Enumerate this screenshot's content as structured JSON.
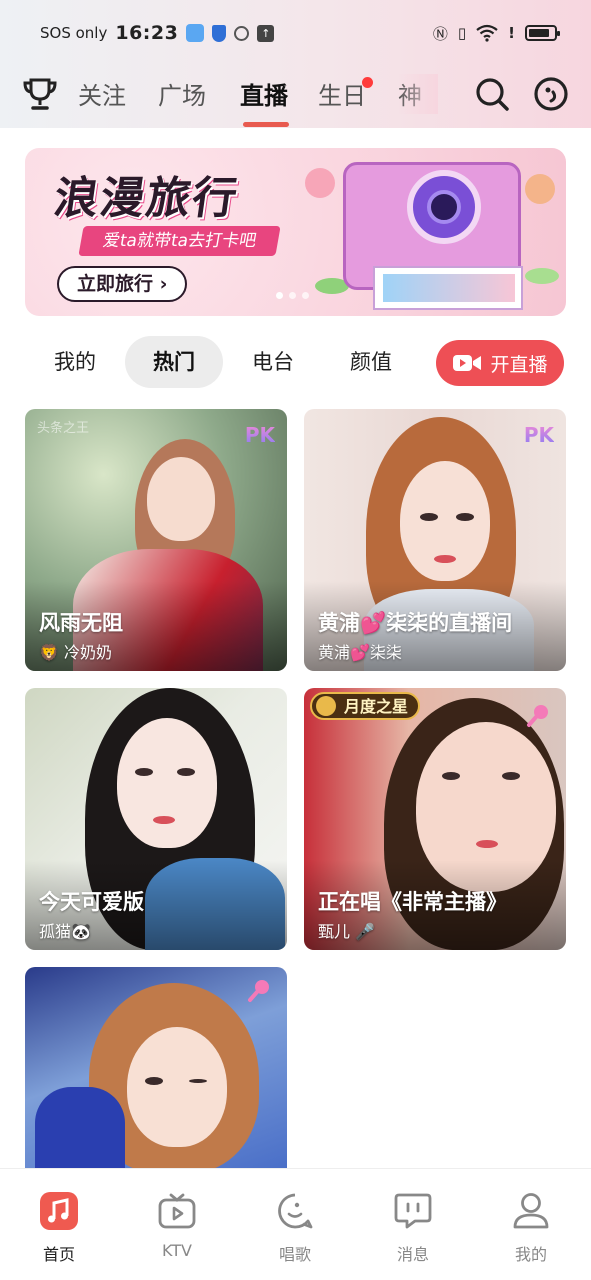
{
  "status_bar": {
    "carrier": "SOS only",
    "time": "16:23"
  },
  "nav": {
    "tabs": [
      {
        "label": "关注"
      },
      {
        "label": "广场"
      },
      {
        "label": "直播"
      },
      {
        "label": "生日"
      },
      {
        "label": "神"
      }
    ],
    "active_tab": "直播",
    "icons": [
      "trophy-icon",
      "search-icon",
      "emoji-face-icon"
    ]
  },
  "banner": {
    "title": "浪漫旅行",
    "subtitle": "爱ta就带ta去打卡吧",
    "button_label": "立即旅行 ›"
  },
  "subtabs": {
    "items": [
      {
        "label": "我的"
      },
      {
        "label": "热门"
      },
      {
        "label": "电台"
      },
      {
        "label": "颜值"
      }
    ],
    "active": "热门",
    "live_button_label": "开直播"
  },
  "rooms": [
    {
      "title": "风雨无阻",
      "host": "🦁 冷奶奶",
      "badge": "PK",
      "corner_text": "头条之王"
    },
    {
      "title": "黄浦💕柒柒的直播间",
      "host": "黄浦💕柒柒",
      "badge": "PK"
    },
    {
      "title": "今天可爱版",
      "host": "孤猫🐼"
    },
    {
      "title": "正在唱《非常主播》",
      "host": "甄儿 🎤",
      "badge": "月度之星"
    },
    {
      "title": "",
      "host": ""
    }
  ],
  "bottom_nav": {
    "items": [
      {
        "label": "首页",
        "icon": "music-note-icon"
      },
      {
        "label": "KTV",
        "icon": "tv-play-icon"
      },
      {
        "label": "唱歌",
        "icon": "sing-icon"
      },
      {
        "label": "消息",
        "icon": "message-icon"
      },
      {
        "label": "我的",
        "icon": "profile-icon"
      }
    ],
    "active": "首页"
  },
  "colors": {
    "accent": "#e85a4f",
    "live_button": "#ee4f55",
    "banner_pink": "#e8457f"
  }
}
